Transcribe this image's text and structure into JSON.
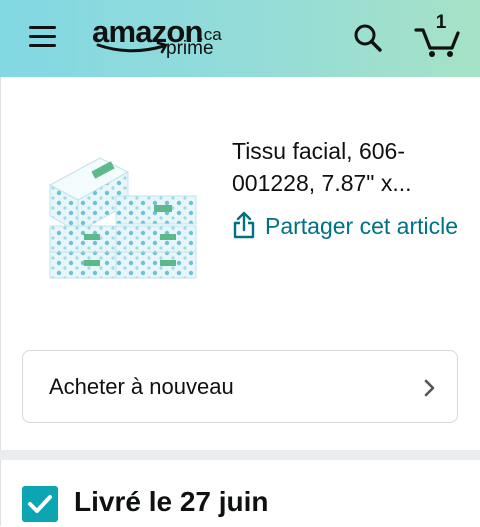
{
  "header": {
    "logo_word": "amazon",
    "logo_ca": ".ca",
    "logo_prime": "prime",
    "cart_count": "1",
    "icons": [
      "menu-icon",
      "search-icon",
      "cart-icon"
    ]
  },
  "product": {
    "title": "Tissu facial, 606-001228, 7.87\" x...",
    "share_label": "Partager cet article"
  },
  "buy_again": {
    "label": "Acheter à nouveau"
  },
  "delivery": {
    "status": "Livré le 27 juin"
  },
  "colors": {
    "header_gradient_start": "#82d8e3",
    "header_gradient_end": "#a6e2c6",
    "link": "#007185",
    "check": "#0ca5b3"
  }
}
